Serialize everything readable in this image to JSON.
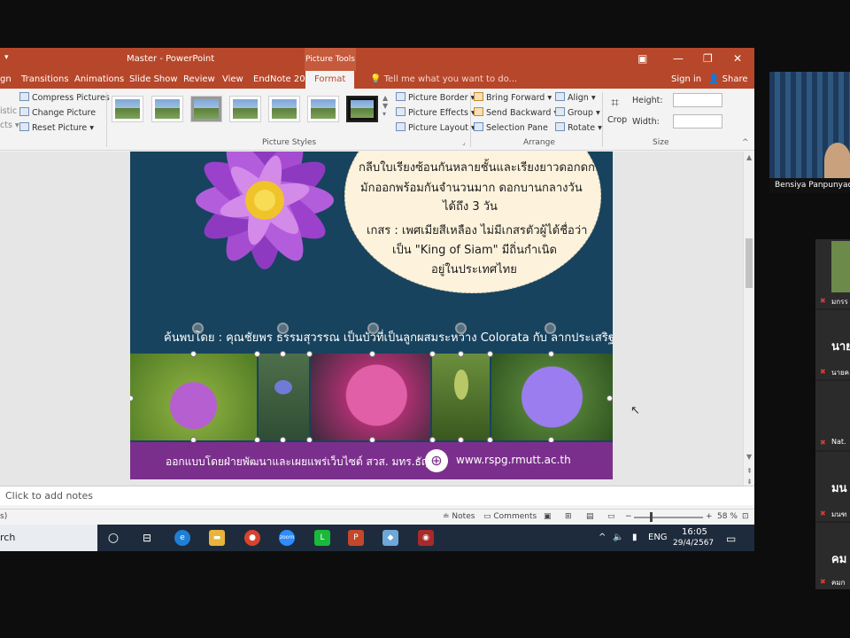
{
  "window": {
    "title": "Master - PowerPoint",
    "context_tab": "Picture Tools",
    "controls": [
      "▣",
      "—",
      "❐",
      "✕"
    ]
  },
  "tabs": [
    {
      "label": "gn"
    },
    {
      "label": "Transitions"
    },
    {
      "label": "Animations"
    },
    {
      "label": "Slide Show"
    },
    {
      "label": "Review"
    },
    {
      "label": "View"
    },
    {
      "label": "EndNote 20"
    },
    {
      "label": "Format"
    }
  ],
  "tell_me": "Tell me what you want to do...",
  "signin": "Sign in",
  "share": "Share",
  "ribbon": {
    "left_partial": [
      "istic",
      "cts ▾"
    ],
    "adjust": [
      "Compress Pictures",
      "Change Picture",
      "Reset Picture"
    ],
    "picture_styles_label": "Picture Styles",
    "picture_options": [
      "Picture Border ▾",
      "Picture Effects ▾",
      "Picture Layout ▾"
    ],
    "arrange": [
      "Bring Forward",
      "Send Backward",
      "Selection Pane"
    ],
    "align": [
      "Align ▾",
      "Group ▾",
      "Rotate ▾"
    ],
    "arrange_label": "Arrange",
    "crop": "Crop",
    "height_label": "Height:",
    "width_label": "Width:",
    "size_label": "Size"
  },
  "slide": {
    "text_lines": [
      "กลีบใบเรียงซ้อนกันหลายชั้นและเรียงยาวดอกดก",
      "มักออกพร้อมกันจำนวนมาก ดอกบานกลางวัน",
      "ได้ถึง 3 วัน",
      "เกสร : เพศเมียสีเหลือง ไม่มีเกสรตัวผู้ได้ชื่อว่า",
      "เป็น \"King of Siam\" มีถิ่นกำเนิด",
      "อยู่ในประเทศไทย"
    ],
    "caption": "ค้นพบโดย : คุณชัยพร ธรรมสุวรรณ เป็นบัวที่เป็นลูกผสมระหว่าง Colorata กับ ลากประเสริฐ",
    "footer": "ออกแบบโดยฝ่ายพัฒนาและเผยแพร่เว็บไซต์ สวส. มทร.ธัญบุรี",
    "url": "www.rspg.rmutt.ac.th",
    "globe": "⊕"
  },
  "notes_placeholder": "Click to add notes",
  "statusbar": {
    "left": "s)",
    "notes": "Notes",
    "comments": "Comments",
    "zoom": "58 %"
  },
  "taskbar": {
    "search": "rch",
    "time": "16:05",
    "date": "29/4/2567",
    "lang": "ENG"
  },
  "meeting": {
    "video_name": "Bensiya Panpunyao",
    "participants": [
      {
        "short": "นาย",
        "sub": "นายค"
      },
      {
        "short": "",
        "sub": "Nat."
      },
      {
        "short": "มน",
        "sub": "มนฑ"
      },
      {
        "short": "คม",
        "sub": "คมก"
      }
    ],
    "first_sub": "มกรร"
  }
}
